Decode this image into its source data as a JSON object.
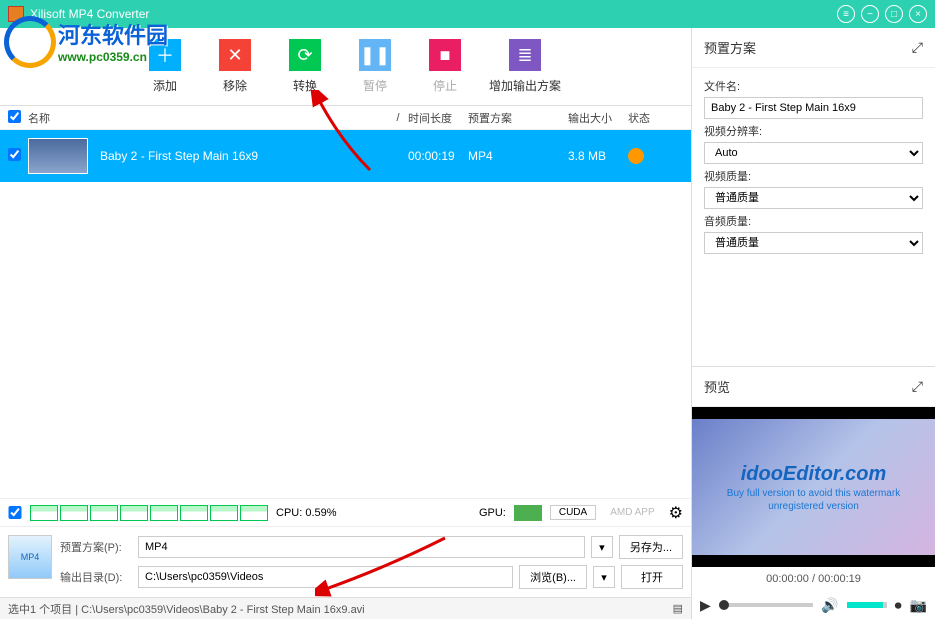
{
  "title": "Xilisoft MP4 Converter",
  "watermark": {
    "cn": "河东软件园",
    "url": "www.pc0359.cn"
  },
  "toolbar": {
    "add": "添加",
    "remove": "移除",
    "convert": "转换",
    "pause": "暂停",
    "stop": "停止",
    "addprofile": "增加输出方案"
  },
  "headers": {
    "name": "名称",
    "duration": "时间长度",
    "profile": "预置方案",
    "size": "输出大小",
    "status": "状态"
  },
  "item": {
    "name": "Baby 2 - First Step Main 16x9",
    "duration": "00:00:19",
    "profile": "MP4",
    "size": "3.8 MB"
  },
  "perf": {
    "cpu_label": "CPU: 0.59%",
    "gpu_label": "GPU:",
    "cuda": "CUDA",
    "amd": "AMD APP"
  },
  "output": {
    "profile_label": "预置方案(P):",
    "profile_value": "MP4",
    "saveas": "另存为...",
    "dest_label": "输出目录(D):",
    "dest_value": "C:\\Users\\pc0359\\Videos",
    "browse": "浏览(B)...",
    "open": "打开"
  },
  "statusbar": "选中1 个项目 | C:\\Users\\pc0359\\Videos\\Baby 2 - First Step Main 16x9.avi",
  "right": {
    "preset_title": "预置方案",
    "filename_label": "文件名:",
    "filename_value": "Baby 2 - First Step Main 16x9",
    "res_label": "视频分辨率:",
    "res_value": "Auto",
    "vq_label": "视频质量:",
    "vq_value": "普通质量",
    "aq_label": "音频质量:",
    "aq_value": "普通质量",
    "preview_title": "预览",
    "pv_logo": "idooEditor.com",
    "pv_wm1": "Buy full version to avoid this watermark",
    "pv_wm2": "unregistered version",
    "pv_time": "00:00:00 / 00:00:19"
  }
}
